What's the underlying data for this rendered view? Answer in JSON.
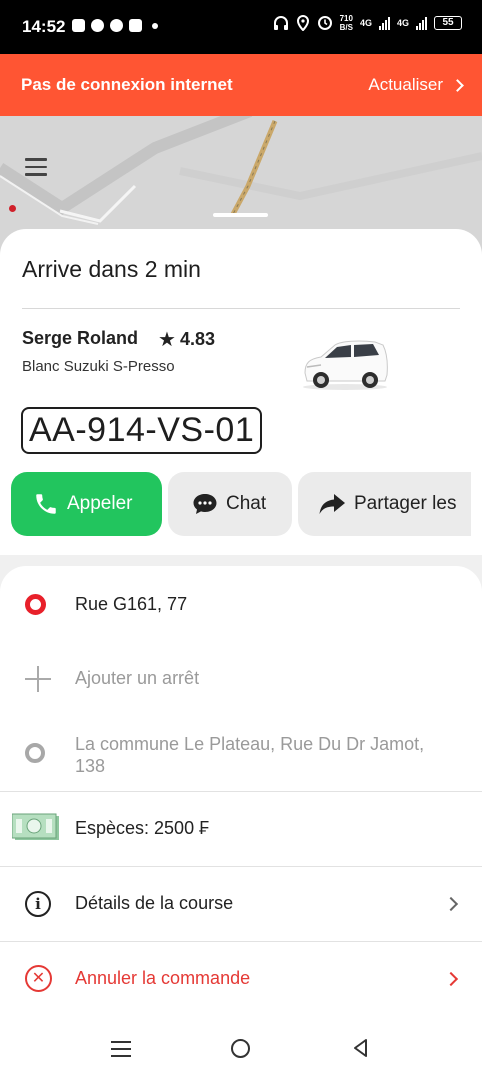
{
  "status_bar": {
    "time": "14:52",
    "net_speed_value": "710",
    "net_speed_unit": "B/S",
    "signal_1": "4G",
    "signal_2": "4G",
    "battery": "55"
  },
  "banner": {
    "message": "Pas de connexion internet",
    "action": "Actualiser"
  },
  "ride": {
    "eta": "Arrive dans 2 min",
    "driver_name": "Serge Roland",
    "rating": "4.83",
    "car": "Blanc Suzuki S-Presso",
    "plate": "AA-914-VS-01"
  },
  "actions": {
    "call": "Appeler",
    "chat": "Chat",
    "share": "Partager les"
  },
  "trip": {
    "pickup": "Rue G161, 77",
    "add_stop": "Ajouter un arrêt",
    "destination_line1": "La commune Le Plateau, Rue Du Dr Jamot,",
    "destination_line2": "138",
    "payment": "Espèces: 2500 ₣",
    "details": "Détails de la course",
    "cancel": "Annuler la commande"
  },
  "colors": {
    "banner": "#ff5533",
    "call_button": "#22c55e",
    "cancel": "#e53935",
    "pickup": "#e8202a"
  }
}
